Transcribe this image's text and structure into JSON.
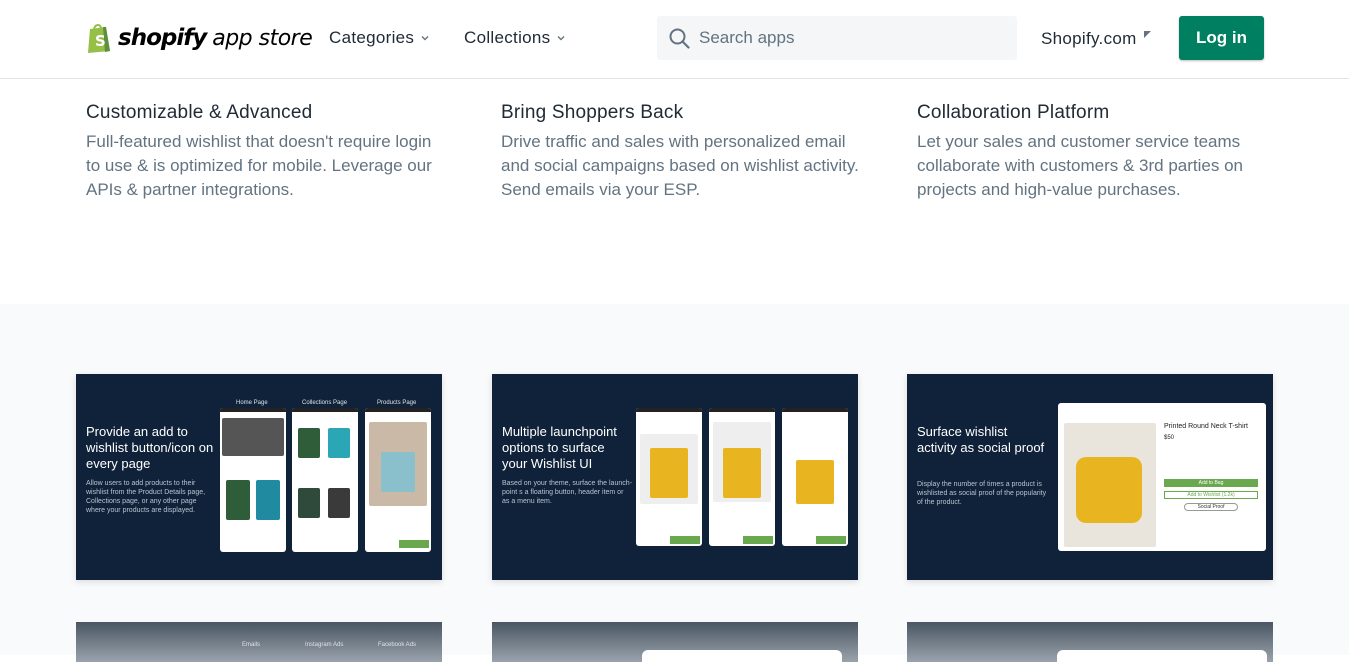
{
  "header": {
    "logo_bold": "shopify",
    "logo_light": "app store",
    "nav": [
      {
        "label": "Categories"
      },
      {
        "label": "Collections"
      }
    ],
    "search_placeholder": "Search apps",
    "shopify_link": "Shopify.com",
    "login_label": "Log in"
  },
  "features": [
    {
      "title": "Customizable & Advanced",
      "lines": [
        "Full-featured wishlist that doesn't require login",
        "to use & is optimized for mobile. Leverage our",
        "APIs & partner integrations."
      ]
    },
    {
      "title": "Bring Shoppers Back",
      "lines": [
        "Drive traffic and sales with personalized email",
        "and social campaigns based on wishlist activity.",
        "Send emails via your ESP."
      ]
    },
    {
      "title": "Collaboration Platform",
      "lines": [
        "Let your sales and customer service teams",
        "collaborate with customers & 3rd parties on",
        "projects and high-value purchases."
      ]
    }
  ],
  "screenshots": [
    {
      "title": "Provide an add to wishlist button/icon on every page",
      "desc": "Allow users to add products to their wishlist from the Product Details page, Collections page, or any other page where your products are displayed.",
      "labels": [
        "Home Page",
        "Collections Page",
        "Products Page"
      ]
    },
    {
      "title": "Multiple launchpoint options to surface your Wishlist UI",
      "desc": "Based on your theme, surface the launch-point s a floating button, header item or as a menu item."
    },
    {
      "title": "Surface wishlist activity as social proof",
      "desc": "Display the number of times a product is wishlisted as social proof of the popularity of the product.",
      "product_name": "Printed Round Neck T-shirt",
      "price": "$50",
      "add_to_bag": "Add to Bag",
      "add_to_wishlist": "Add to Wishlist (1.2k)",
      "social_proof": "Social Proof"
    }
  ],
  "bottom_labels": [
    "Emails",
    "Instagram Ads",
    "Facebook Ads"
  ],
  "colors": {
    "brand_green": "#008060",
    "card_bg": "#0f2239",
    "shirt_yellow": "#e8b521"
  }
}
